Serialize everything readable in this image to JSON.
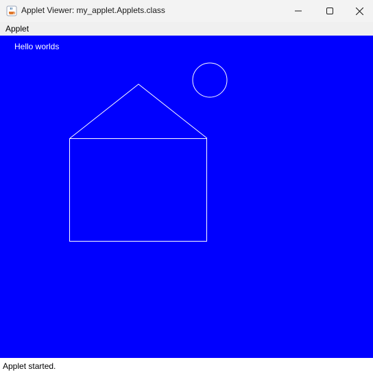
{
  "window": {
    "title": "Applet Viewer: my_applet.Applets.class",
    "icon": "java-cup-icon",
    "controls": {
      "minimize_icon": "minimize-icon",
      "maximize_icon": "maximize-icon",
      "close_icon": "close-icon"
    }
  },
  "menubar": {
    "items": [
      {
        "label": "Applet"
      }
    ]
  },
  "applet": {
    "background_color": "#0000ff",
    "stroke_color": "#ffffff",
    "text": "Hello worlds"
  },
  "status": {
    "text": "Applet started."
  }
}
